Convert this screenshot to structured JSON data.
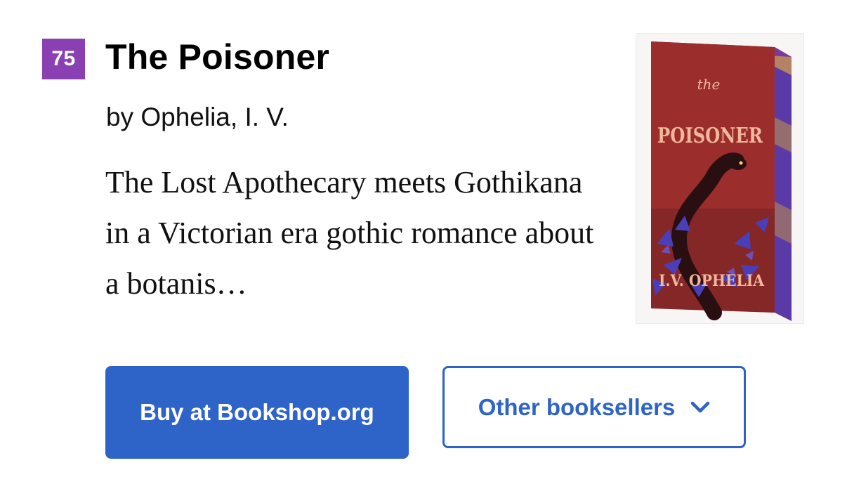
{
  "rank": "75",
  "book": {
    "title": "The Poisoner",
    "author": "by Ophelia, I. V.",
    "description": "The Lost Apothecary meets Gothikana in a Victorian era gothic romance about a botanis…"
  },
  "cover": {
    "title_small": "the",
    "title_main": "POISONER",
    "author_name": "I.V. OPHELIA",
    "colors": {
      "background": "#9b2d2c",
      "lettering": "#f0b79a",
      "flowers": "#4a3fb8",
      "serpent": "#2a0f12",
      "spine_edge": "#6b3fb0"
    }
  },
  "actions": {
    "buy_label": "Buy at Bookshop.org",
    "other_label": "Other booksellers",
    "other_icon": "chevron-down-icon"
  },
  "colors": {
    "badge": "#8a3fb3",
    "primary": "#2e63c7"
  }
}
